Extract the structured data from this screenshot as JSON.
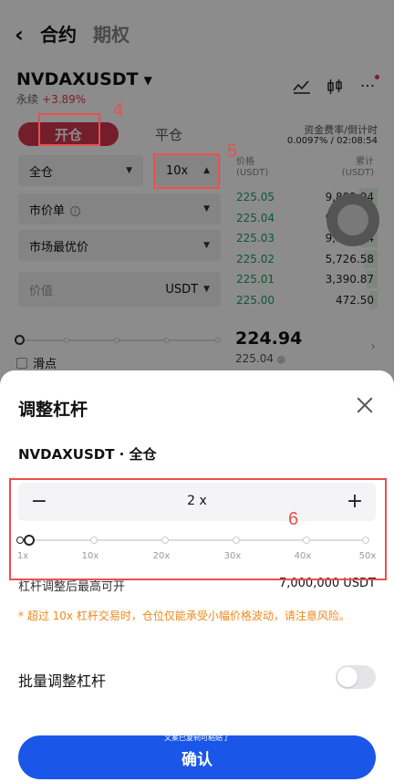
{
  "nav": {
    "back_icon": "chevron-left-icon",
    "tab_active": "合约",
    "tab_other": "期权"
  },
  "market": {
    "symbol": "NVDAXUSDT",
    "type": "永续",
    "change": "+3.89%"
  },
  "toolbar": {
    "icons": [
      "indicator-icon",
      "candlestick-icon",
      "more-icon"
    ]
  },
  "order_mode": {
    "open": "开仓",
    "close": "平仓"
  },
  "funding": {
    "label": "资金费率/倒计时",
    "value": "0.0097% / 02:08:54"
  },
  "form": {
    "margin_mode": "全仓",
    "leverage": "10x",
    "order_type": "市价单",
    "price_type": "市场最优价",
    "value_placeholder": "价值",
    "value_unit": "USDT",
    "slippage": "滑点"
  },
  "orderbook": {
    "price_header": [
      "价格",
      "(USDT)"
    ],
    "amount_header": [
      "累计",
      "(USDT)"
    ],
    "rows": [
      {
        "price": "225.05",
        "amount": "9,882.94",
        "depth": 1.0
      },
      {
        "price": "225.04",
        "amount": "9,403.58",
        "depth": 0.95
      },
      {
        "price": "225.03",
        "amount": "9,178.54",
        "depth": 0.93
      },
      {
        "price": "225.02",
        "amount": "5,726.58",
        "depth": 0.58
      },
      {
        "price": "225.01",
        "amount": "3,390.87",
        "depth": 0.34
      },
      {
        "price": "225.00",
        "amount": "472.50",
        "depth": 0.05
      }
    ],
    "last_price": "224.94",
    "mark_price": "225.04"
  },
  "annotations": {
    "n4": "4",
    "n5": "5",
    "n6": "6"
  },
  "sheet": {
    "title": "调整杠杆",
    "subtitle": "NVDAXUSDT · 全仓",
    "stepper_minus": "−",
    "stepper_value": "2 x",
    "stepper_plus": "+",
    "leverage_labels": [
      "1x",
      "10x",
      "20x",
      "30x",
      "40x",
      "50x"
    ],
    "max_pos_label": "杠杆调整后最高可开",
    "max_pos_value": "7,000,000 USDT",
    "warning": "* 超过 10x 杠杆交易时，仓位仅能承受小幅价格波动，请注意风险。",
    "batch_label": "批量调整杠杆",
    "batch_enabled": false,
    "confirm_caption": "文案已复制可粘贴了",
    "confirm": "确认"
  },
  "colors": {
    "accent": "#1a56e8",
    "long_red": "#d5374f",
    "bid_green": "#1d9d63",
    "warning": "#f0891a",
    "annotation": "#ec4f4f"
  }
}
